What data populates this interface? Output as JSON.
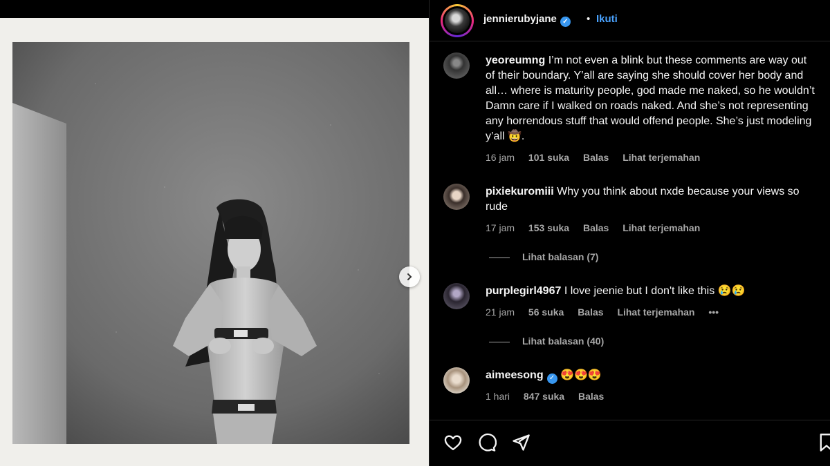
{
  "post": {
    "username": "jennierubyjane",
    "separator": "•",
    "follow_label": "Ikuti"
  },
  "comments": [
    {
      "username": "yeoreumng",
      "text": "I’m not even a blink but these comments are way out of their boundary. Y’all are saying she should cover her body and all… where is maturity people, god made me naked, so he wouldn’t Damn care if I walked on roads naked. And she’s not representing any horrendous stuff that would offend people. She’s just modeling y’all 🤠.",
      "time": "16 jam",
      "likes": "101 suka",
      "reply": "Balas",
      "translate": "Lihat terjemahan"
    },
    {
      "username": "pixiekuromiii",
      "text": "Why you think about nxde because your views so rude",
      "time": "17 jam",
      "likes": "153 suka",
      "reply": "Balas",
      "translate": "Lihat terjemahan",
      "view_replies": "Lihat balasan (7)"
    },
    {
      "username": "purplegirl4967",
      "text": "I love jeenie but I don't like this 😢😢",
      "time": "21 jam",
      "likes": "56 suka",
      "reply": "Balas",
      "translate": "Lihat terjemahan",
      "more": "•••",
      "view_replies": "Lihat balasan (40)"
    },
    {
      "username": "aimeesong",
      "text": "😍😍😍",
      "time": "1 hari",
      "likes": "847 suka",
      "reply": "Balas"
    }
  ],
  "icons": {
    "like": "heart-icon",
    "comment": "comment-icon",
    "share": "send-icon",
    "save": "bookmark-icon",
    "next": "chevron-right-icon",
    "verified": "verified-badge-icon"
  },
  "colors": {
    "link": "#4aa3ff",
    "verified": "#3897f0",
    "muted": "#a8a8a8"
  }
}
